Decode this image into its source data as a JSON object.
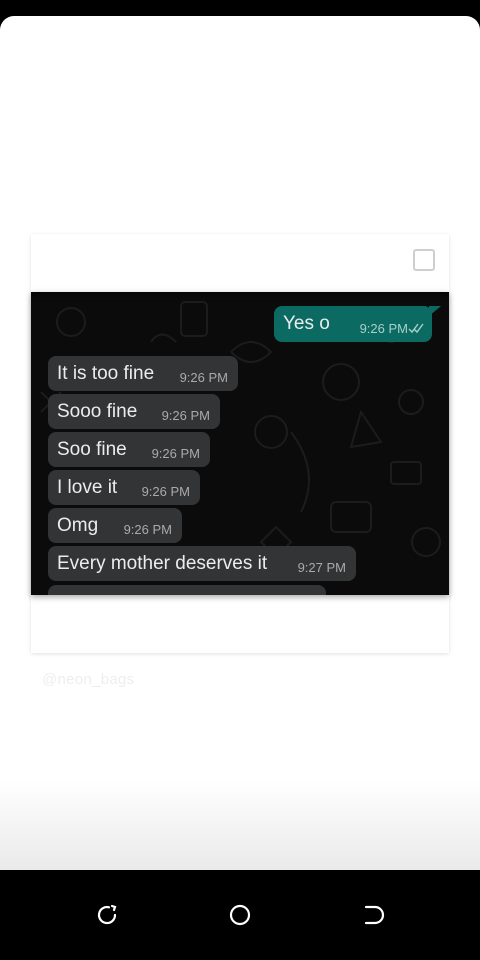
{
  "chat": {
    "messages": [
      {
        "direction": "out",
        "text": "Yes o",
        "time": "9:26 PM",
        "status": "double-tick-icon"
      },
      {
        "direction": "in",
        "text": "It is too fine",
        "time": "9:26 PM"
      },
      {
        "direction": "in",
        "text": "Sooo fine",
        "time": "9:26 PM"
      },
      {
        "direction": "in",
        "text": "Soo fine",
        "time": "9:26 PM"
      },
      {
        "direction": "in",
        "text": "I love it",
        "time": "9:26 PM"
      },
      {
        "direction": "in",
        "text": "Omg",
        "time": "9:26 PM"
      },
      {
        "direction": "in",
        "text": "Every mother deserves it",
        "time": "9:27 PM"
      }
    ]
  },
  "watermark": "@neon_bags",
  "colors": {
    "incoming_bubble": "#333436",
    "outgoing_bubble": "#0b6b63",
    "chat_background": "#0b0b0b"
  },
  "navbar": {
    "icons": [
      "recent-apps-icon",
      "home-icon",
      "back-icon"
    ]
  }
}
